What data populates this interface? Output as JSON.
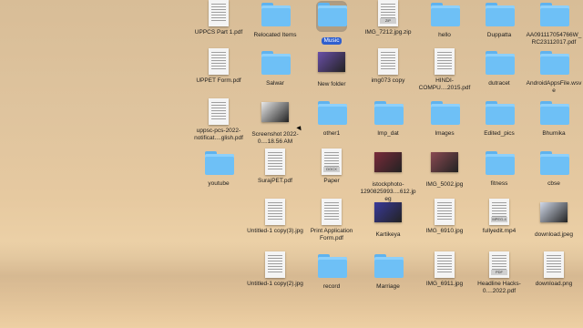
{
  "desktop": {
    "items": [
      {
        "label": "UPPCS Part 1.pdf",
        "type": "doc",
        "icon": "pdf-document-icon"
      },
      {
        "label": "Relocated Items",
        "type": "folder",
        "icon": "folder-icon"
      },
      {
        "label": "Music",
        "type": "folder",
        "icon": "folder-icon",
        "selected": true
      },
      {
        "label": "IMG_7212.jpg.zip",
        "type": "doc",
        "icon": "zip-archive-icon",
        "tag": "ZIP"
      },
      {
        "label": "hello",
        "type": "folder",
        "icon": "folder-icon"
      },
      {
        "label": "Duppatta",
        "type": "folder",
        "icon": "folder-icon"
      },
      {
        "label": "AA091117054766W_RC23112017.pdf",
        "type": "folder",
        "icon": "folder-icon"
      },
      {
        "label": "UPPET Form.pdf",
        "type": "doc",
        "icon": "pdf-document-icon"
      },
      {
        "label": "Salwar",
        "type": "folder",
        "icon": "folder-icon"
      },
      {
        "label": "New folder",
        "type": "photo",
        "icon": "image-thumbnail-icon",
        "color": "#6a4fa8"
      },
      {
        "label": "img073 copy",
        "type": "doc",
        "icon": "image-document-icon"
      },
      {
        "label": "HINDI-COMPU....2015.pdf",
        "type": "doc",
        "icon": "pdf-document-icon"
      },
      {
        "label": "dutracet",
        "type": "folder",
        "icon": "folder-icon"
      },
      {
        "label": "AndroidAppsFile.wsve",
        "type": "folder",
        "icon": "folder-icon"
      },
      {
        "label": "uppsc-pcs-2022-notificat....glish.pdf",
        "type": "doc",
        "icon": "pdf-document-icon"
      },
      {
        "label": "Screenshot 2022-0....18.56 AM",
        "type": "photo",
        "icon": "screenshot-thumbnail-icon",
        "color": "#e8e8e8"
      },
      {
        "label": "other1",
        "type": "folder",
        "icon": "folder-icon"
      },
      {
        "label": "Imp_dat",
        "type": "folder",
        "icon": "folder-icon"
      },
      {
        "label": "Images",
        "type": "folder",
        "icon": "folder-icon"
      },
      {
        "label": "Edited_pics",
        "type": "folder",
        "icon": "folder-icon"
      },
      {
        "label": "Bhumika",
        "type": "folder",
        "icon": "folder-icon"
      },
      {
        "label": "youtube",
        "type": "folder",
        "icon": "folder-icon"
      },
      {
        "label": "SurajPET.pdf",
        "type": "doc",
        "icon": "pdf-document-icon"
      },
      {
        "label": "Paper",
        "type": "doc",
        "icon": "docx-document-icon",
        "tag": "DOCX"
      },
      {
        "label": "istockphoto-1290825993....612.jpeg",
        "type": "photo",
        "icon": "image-thumbnail-icon",
        "color": "#7a2b3a"
      },
      {
        "label": "IMG_5002.jpg",
        "type": "photo",
        "icon": "image-thumbnail-icon",
        "color": "#8a4a52"
      },
      {
        "label": "fitness",
        "type": "folder",
        "icon": "folder-icon"
      },
      {
        "label": "cbse",
        "type": "folder",
        "icon": "folder-icon"
      },
      {
        "label": "Untitled-1 copy(3).jpg",
        "type": "doc",
        "icon": "photo-id-icon"
      },
      {
        "label": "Print Application Form.pdf",
        "type": "doc",
        "icon": "pdf-document-icon"
      },
      {
        "label": "Kartikeya",
        "type": "photo",
        "icon": "image-thumbnail-icon",
        "color": "#3a3a9a"
      },
      {
        "label": "IMG_6910.jpg",
        "type": "doc",
        "icon": "image-document-icon"
      },
      {
        "label": "fullyedit.mp4",
        "type": "doc",
        "icon": "video-file-icon",
        "tag": "MPEG-4"
      },
      {
        "label": "download.jpeg",
        "type": "photo",
        "icon": "image-thumbnail-icon",
        "color": "#d0d8e8"
      },
      {
        "label": "Untitled-1 copy(2).jpg",
        "type": "doc",
        "icon": "photo-id-icon"
      },
      {
        "label": "record",
        "type": "folder",
        "icon": "folder-icon"
      },
      {
        "label": "Marriage",
        "type": "folder",
        "icon": "folder-icon"
      },
      {
        "label": "IMG_6911.jpg",
        "type": "doc",
        "icon": "image-document-icon"
      },
      {
        "label": "Headline Hacks-0....2022.pdf",
        "type": "doc",
        "icon": "pdf-document-icon",
        "tag": "PDF"
      },
      {
        "label": "download.png",
        "type": "doc",
        "icon": "png-image-icon"
      }
    ]
  }
}
